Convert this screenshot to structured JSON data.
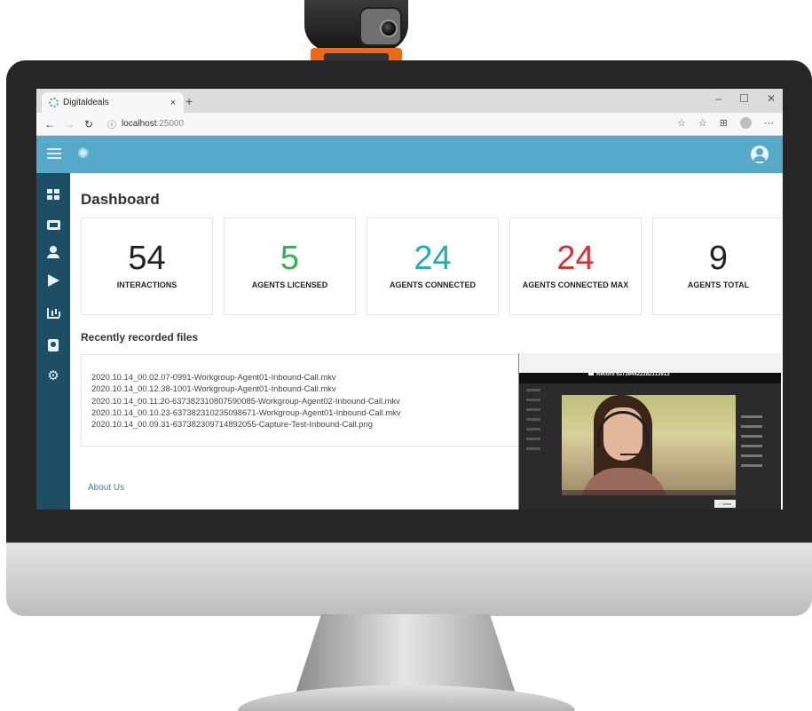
{
  "browser": {
    "tab_title": "Digitaldeals",
    "tab_close": "×",
    "new_tab": "+",
    "url_host": "localhost",
    "url_port": ":25000",
    "win_min": "–",
    "win_max": "☐",
    "win_close": "✕"
  },
  "dashboard": {
    "title": "Dashboard",
    "stats": [
      {
        "value": "54",
        "label": "INTERACTIONS",
        "color": "#222222"
      },
      {
        "value": "5",
        "label": "AGENTS LICENSED",
        "color": "#2eb34f"
      },
      {
        "value": "24",
        "label": "AGENTS CONNECTED",
        "color": "#25aab3"
      },
      {
        "value": "24",
        "label": "AGENTS CONNECTED MAX",
        "color": "#d63031"
      },
      {
        "value": "9",
        "label": "AGENTS TOTAL",
        "color": "#222222"
      }
    ],
    "recent_title": "Recently recorded files",
    "files": [
      "2020.10.14_00.02.07-0991-Workgroup-Agent01-Inbound-Call.mkv",
      "2020.10.14_00.12.38-1001-Workgroup-Agent01-Inbound-Call.mkv",
      "2020.10.14_00.11.20-637382310807590085-Workgroup-Agent02-Inbound-Call.mkv",
      "2020.10.14_00.10.23-637382310235098671-Workgroup-Agent01-Inbound-Call.mkv",
      "2020.10.14_00.09.31-637382309714892055-Capture-Test-Inbound-Call.png"
    ],
    "about_link": "About Us"
  },
  "preview": {
    "record_title": "Record 637394422282313913",
    "close_label": "✓ Close"
  },
  "colors": {
    "header": "#56a9c9",
    "sidebar": "#1d4e66",
    "link": "#3c7fc0"
  }
}
